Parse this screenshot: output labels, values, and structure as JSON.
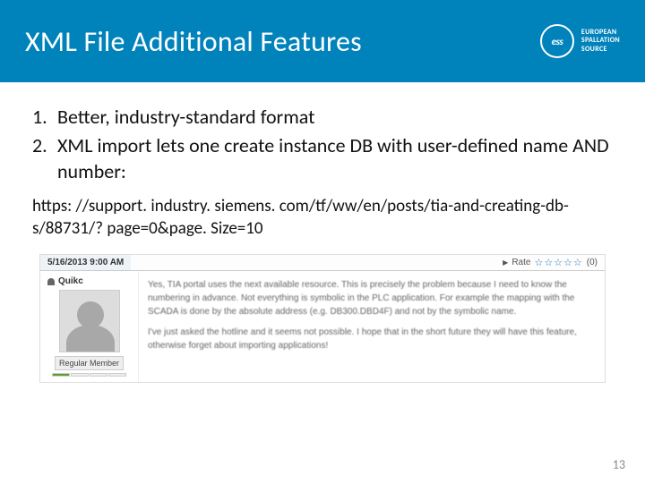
{
  "header": {
    "title": "XML File Additional Features",
    "logo_abbr": "ess",
    "logo_line1": "EUROPEAN",
    "logo_line2": "SPALLATION",
    "logo_line3": "SOURCE"
  },
  "list": {
    "item1_num": "1.",
    "item1_text": "Better, industry-standard format",
    "item2_num": "2.",
    "item2_text": "XML import lets one create instance DB with user-defined name AND number:"
  },
  "url": "https: //support. industry. siemens. com/tf/ww/en/posts/tia-and-creating-db-s/88731/? page=0&page. Size=10",
  "forum": {
    "date": "5/16/2013 9:00 AM",
    "rate_label": "Rate",
    "stars": "☆☆☆☆☆",
    "count": "(0)",
    "user": "Quikc",
    "member": "Regular Member",
    "para1": "Yes, TIA portal uses the next available resource. This is precisely the problem because I need to know the numbering in advance. Not everything is symbolic in the PLC application. For example the mapping with the SCADA is done by the absolute address (e.g. DB300.DBD4F) and not by the symbolic name.",
    "para2": "I've just asked the hotline and it seems not possible. I hope that in the short future they will have this feature, otherwise forget about importing applications!"
  },
  "page_number": "13"
}
